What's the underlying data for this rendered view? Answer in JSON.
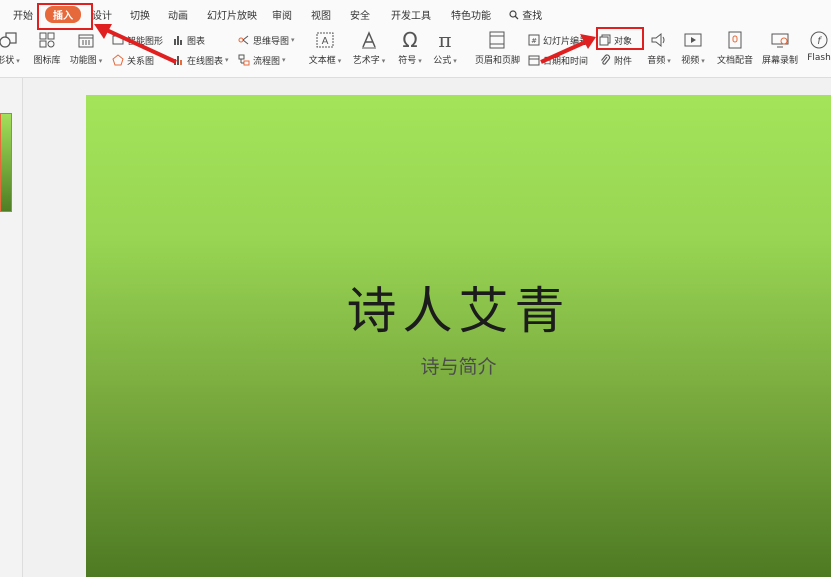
{
  "menu": {
    "tabs": [
      "开始",
      "插入",
      "设计",
      "切换",
      "动画",
      "幻灯片放映",
      "审阅",
      "视图",
      "安全",
      "开发工具",
      "特色功能"
    ],
    "search_label": "查找"
  },
  "ribbon": {
    "shape_label": "形状",
    "icon_library_label": "图标库",
    "function_chart_label": "功能图",
    "smart_art_label": "智能图形",
    "relation_label": "关系图",
    "chart_label": "图表",
    "online_chart_label": "在线图表",
    "mind_map_label": "思维导图",
    "flowchart_label": "流程图",
    "textbox_label": "文本框",
    "wordart_label": "艺术字",
    "symbol_label": "符号",
    "formula_label": "公式",
    "header_footer_label": "页眉和页脚",
    "slide_number_label": "幻灯片编号",
    "object_label": "对象",
    "datetime_label": "日期和时间",
    "attachment_label": "附件",
    "audio_label": "音频",
    "video_label": "视频",
    "doc_dubbing_label": "文档配音",
    "screen_record_label": "屏幕录制",
    "flash_label": "Flash"
  },
  "slide": {
    "title": "诗人艾青",
    "subtitle": "诗与简介"
  },
  "colors": {
    "accent": "#e5693b",
    "highlight": "#e02020",
    "slide_top": "#a3e45a",
    "slide_bottom": "#4e7a23"
  }
}
